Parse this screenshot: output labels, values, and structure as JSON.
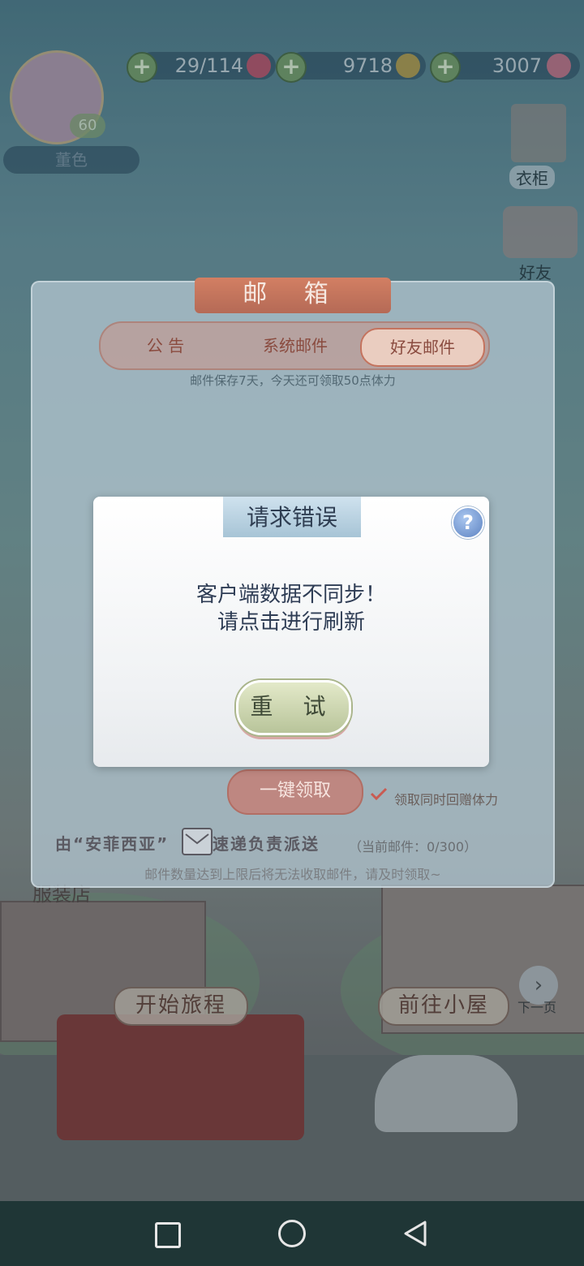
{
  "top_bar": {
    "player_name": "董色",
    "player_level": "60",
    "stamina": "29/114",
    "gold": "9718",
    "diamonds": "3007"
  },
  "side_menu": {
    "wardrobe": "衣柜",
    "friends": "好友"
  },
  "scene": {
    "start_journey": "开始旅程",
    "go_to_house": "前往小屋",
    "next_page": "下一页",
    "clothing_store": "服装店"
  },
  "mailbox": {
    "title": "邮 箱",
    "tabs": [
      {
        "label": "公 告"
      },
      {
        "label": "系统邮件"
      },
      {
        "label": "好友邮件"
      }
    ],
    "note": "邮件保存7天，今天还可领取50点体力",
    "claim_all": "一键领取",
    "gift_option": "领取同时回赠体力",
    "courier_left": "由“安菲西亚”",
    "courier_right": "速递负责派送",
    "mail_count": "（当前邮件：0/300）",
    "warning": "邮件数量达到上限后将无法收取邮件，请及时领取~"
  },
  "dialog": {
    "title": "请求错误",
    "message_line1": "客户端数据不同步！",
    "message_line2": "请点击进行刷新",
    "retry_button": "重 试",
    "help_symbol": "?"
  },
  "colors": {
    "accent_mail": "#c4735e",
    "dialog_title": "#2f3e52",
    "retry_green": "#b8c49a",
    "nav_bar": "#1f3636"
  }
}
